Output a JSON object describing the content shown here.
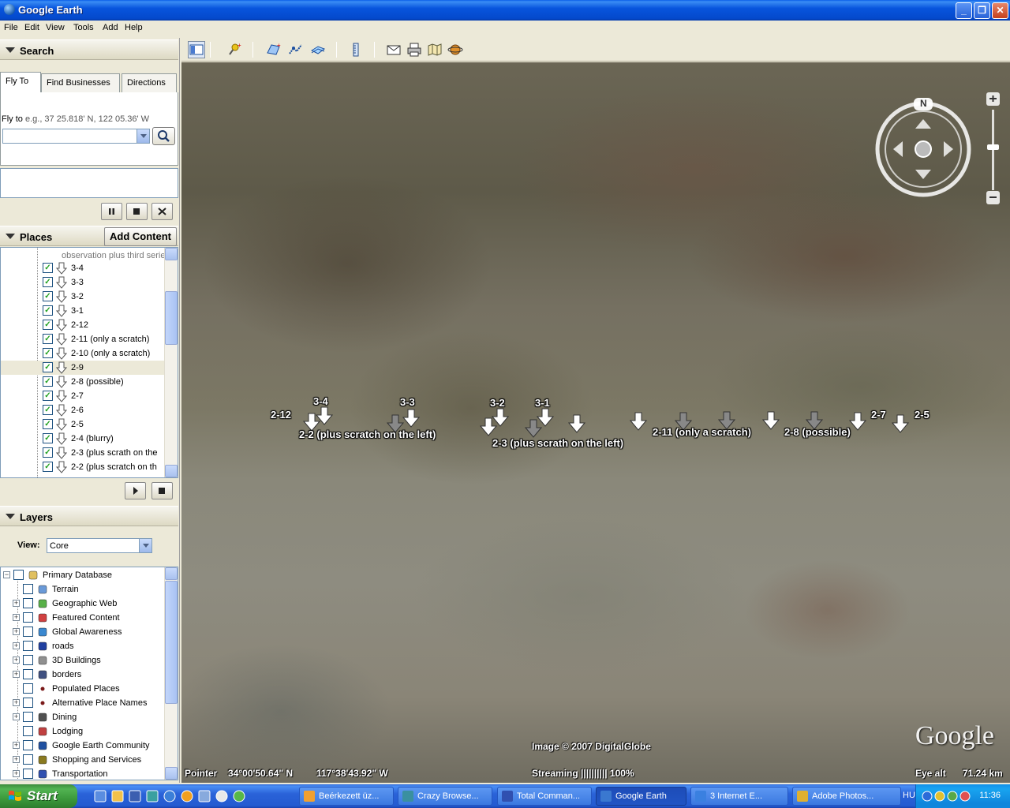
{
  "window": {
    "title": "Google Earth"
  },
  "menu": [
    "File",
    "Edit",
    "View",
    "Tools",
    "Add",
    "Help"
  ],
  "search": {
    "header": "Search",
    "tabs": [
      "Fly To",
      "Find Businesses",
      "Directions"
    ],
    "fly_label": "Fly to",
    "fly_hint": "e.g., 37 25.818' N, 122 05.36' W",
    "input_value": ""
  },
  "places": {
    "header": "Places",
    "add_content": "Add Content",
    "top_text": "observation plus third serie",
    "items": [
      {
        "label": "3-4",
        "checked": true
      },
      {
        "label": "3-3",
        "checked": true
      },
      {
        "label": "3-2",
        "checked": true
      },
      {
        "label": "3-1",
        "checked": true
      },
      {
        "label": "2-12",
        "checked": true
      },
      {
        "label": "2-11 (only a scratch)",
        "checked": true
      },
      {
        "label": "2-10 (only a scratch)",
        "checked": true
      },
      {
        "label": "2-9",
        "checked": true,
        "selected": true
      },
      {
        "label": "2-8 (possible)",
        "checked": true
      },
      {
        "label": "2-7",
        "checked": true
      },
      {
        "label": "2-6",
        "checked": true
      },
      {
        "label": "2-5",
        "checked": true
      },
      {
        "label": "2-4 (blurry)",
        "checked": true
      },
      {
        "label": "2-3 (plus scrath on the",
        "checked": true
      },
      {
        "label": "2-2 (plus scratch on th",
        "checked": true
      }
    ]
  },
  "layers": {
    "header": "Layers",
    "view_label": "View:",
    "view_value": "Core",
    "items": [
      {
        "label": "Primary Database",
        "icon": "database-icon"
      },
      {
        "label": "Terrain",
        "icon": "terrain-icon"
      },
      {
        "label": "Geographic Web",
        "icon": "geographic-web-icon"
      },
      {
        "label": "Featured Content",
        "icon": "featured-content-icon"
      },
      {
        "label": "Global Awareness",
        "icon": "globe-icon"
      },
      {
        "label": "roads",
        "icon": "road-sign-icon"
      },
      {
        "label": "3D Buildings",
        "icon": "building-icon"
      },
      {
        "label": "borders",
        "icon": "border-flag-icon"
      },
      {
        "label": "Populated Places",
        "icon": "dot-icon"
      },
      {
        "label": "Alternative Place Names",
        "icon": "dot-icon"
      },
      {
        "label": "Dining",
        "icon": "dining-icon"
      },
      {
        "label": "Lodging",
        "icon": "lodging-icon"
      },
      {
        "label": "Google Earth Community",
        "icon": "info-icon"
      },
      {
        "label": "Shopping and Services",
        "icon": "shopping-icon"
      },
      {
        "label": "Transportation",
        "icon": "airplane-icon"
      }
    ]
  },
  "map": {
    "labels": [
      "3-4",
      "2-12",
      "3-3",
      "3-2",
      "3-1",
      "2-7",
      "2-5",
      "2-2 (plus scratch on the left)",
      "2-3 (plus scrath on the left)",
      "2-11 (only a scratch)",
      "2-8 (possible)"
    ],
    "image_credit": "Image © 2007 DigitalGlobe",
    "pointer_label": "Pointer",
    "pointer_lat": "34°00'50.64\" N",
    "pointer_lon": "117°38'43.92\" W",
    "streaming": "Streaming |||||||||| 100%",
    "eye_alt_label": "Eye alt",
    "eye_alt_value": "71.24 km",
    "logo": "Google",
    "compass_north": "N"
  },
  "taskbar": {
    "start": "Start",
    "items": [
      {
        "label": "Beérkezett üz...",
        "active": false
      },
      {
        "label": "Crazy Browse...",
        "active": false
      },
      {
        "label": "Total Comman...",
        "active": false
      },
      {
        "label": "Google Earth",
        "active": true
      },
      {
        "label": "3 Internet E...",
        "active": false
      },
      {
        "label": "Adobe Photos...",
        "active": false
      }
    ],
    "lang": "HU",
    "clock": "11:36"
  }
}
